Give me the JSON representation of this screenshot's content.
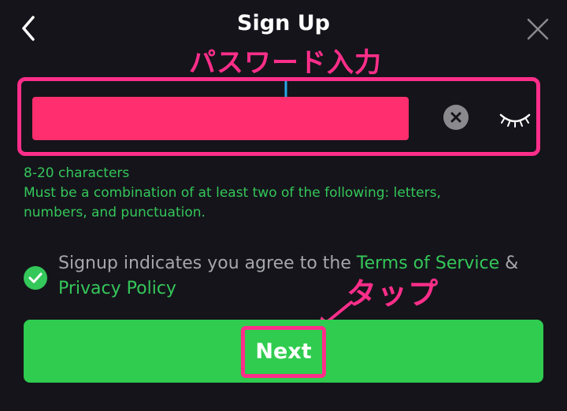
{
  "header": {
    "title": "Sign Up",
    "back_icon": "chevron-left-icon",
    "close_icon": "close-icon"
  },
  "annotations": {
    "password_label": "パスワード入力",
    "tap_label": "タップ",
    "color": "#ff2e8a",
    "arrow_color": "#2aa7e6"
  },
  "password_field": {
    "value": "",
    "clear_icon": "clear-circle-icon",
    "visibility_icon": "eye-closed-icon"
  },
  "hints": {
    "line1": "8-20 characters",
    "line2": "Must be a combination of at least two of the following: letters,",
    "line3": "numbers, and punctuation."
  },
  "terms": {
    "prefix": "Signup indicates you agree to the ",
    "terms_link": "Terms of Service",
    "ampersand": " &",
    "privacy_link": "Privacy Policy",
    "checked": true
  },
  "next_button": {
    "label": "Next"
  },
  "colors": {
    "background": "#15141b",
    "accent_green": "#34c759",
    "button_green": "#2fcc4f",
    "highlight_pink": "#ff2e8a"
  }
}
